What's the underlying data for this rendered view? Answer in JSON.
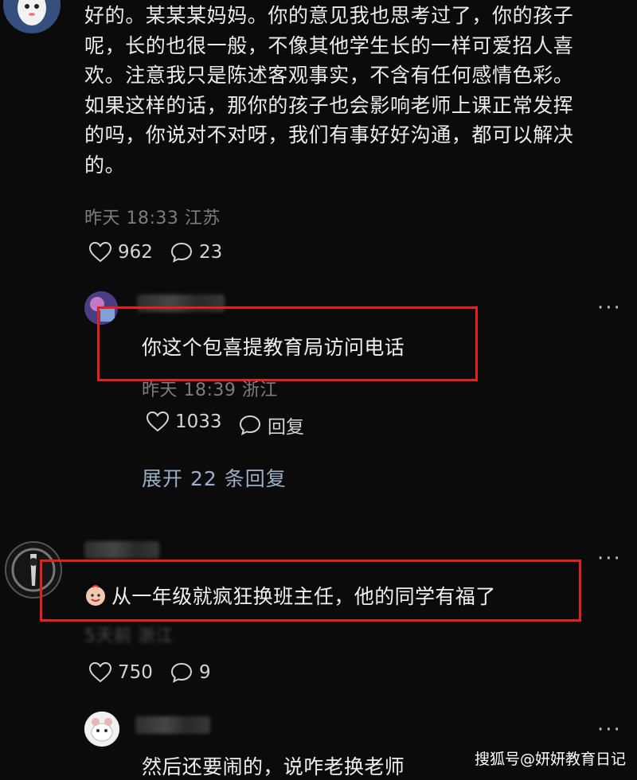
{
  "comment_main": {
    "lines": [
      "好的。某某某妈妈。你的意见我也思考过了，你的孩子",
      "呢，长的也很一般，不像其他学生长的一样可爱招人喜",
      "欢。注意我只是陈述客观事实，不含有任何感情色彩。",
      "如果这样的话，那你的孩子也会影响老师上课正常发挥",
      "的吗，你说对不对呀，我们有事好好沟通，都可以解决",
      "的。"
    ],
    "meta": "昨天 18:33 江苏",
    "likes": "962",
    "replies": "23"
  },
  "reply1": {
    "text": "你这个包喜提教育局访问电话",
    "meta": "昨天 18:39 浙江",
    "likes": "1033",
    "reply_label": "回复",
    "expand_label": "展开 22 条回复"
  },
  "comment2": {
    "text": "从一年级就疯狂换班主任，他的同学有福了",
    "meta": "5天前 浙江",
    "likes": "750",
    "replies": "9"
  },
  "comment3": {
    "text": "然后还要闹的，说咋老换老师"
  },
  "more_label": "···",
  "watermark": "搜狐号@妍妍教育日记",
  "colors": {
    "highlight_box": "#e41f1f",
    "background": "#0b0b0b",
    "expand_link": "#9ab0c8"
  },
  "icons": [
    "heart-icon",
    "comment-bubble-icon",
    "more-icon"
  ]
}
